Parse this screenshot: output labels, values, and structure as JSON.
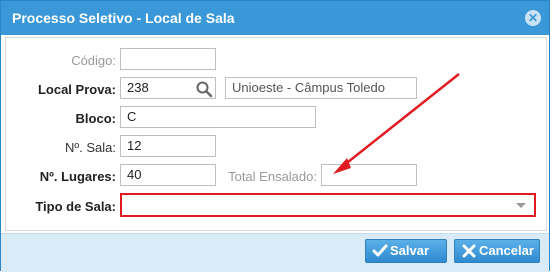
{
  "dialog": {
    "title": "Processo Seletivo - Local de Sala",
    "close_icon": "close-circle-icon"
  },
  "form": {
    "codigo": {
      "label": "Código:",
      "value": ""
    },
    "local_prova": {
      "label": "Local Prova:",
      "value": "238",
      "description": "Unioeste - Câmpus Toledo",
      "search_icon": "search-icon"
    },
    "bloco": {
      "label": "Bloco:",
      "value": "C"
    },
    "sala": {
      "label": "Nº. Sala:",
      "value": "12"
    },
    "lugares": {
      "label": "Nº. Lugares:",
      "value": "40"
    },
    "total_ensalado": {
      "label": "Total Ensalado:",
      "value": ""
    },
    "tipo_sala": {
      "label": "Tipo de Sala:",
      "value": ""
    }
  },
  "footer": {
    "save_label": "Salvar",
    "cancel_label": "Cancelar"
  },
  "colors": {
    "titlebar": "#3a98d8",
    "highlight": "#e01b22",
    "button": "#2e8ad0"
  }
}
